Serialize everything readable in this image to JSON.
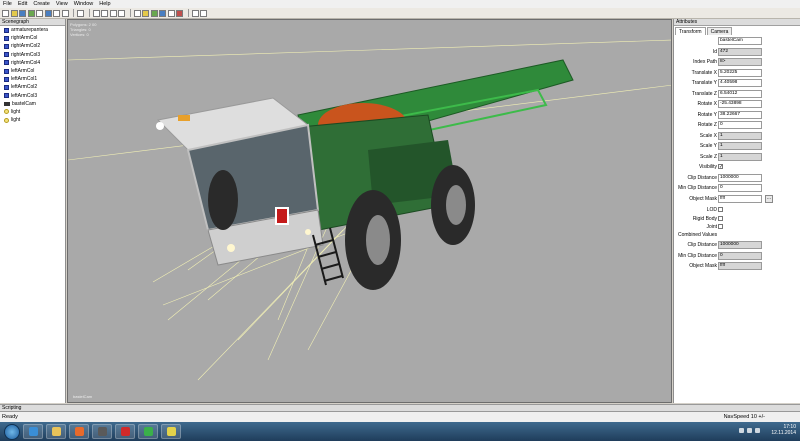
{
  "menu": [
    "File",
    "Edit",
    "Create",
    "View",
    "Window",
    "Help"
  ],
  "scenegraph": {
    "title": "Scenegraph",
    "items": [
      {
        "label": "armaturepantera",
        "icon": "node"
      },
      {
        "label": "rightArmCol",
        "icon": "node"
      },
      {
        "label": "rightArmCol2",
        "icon": "node"
      },
      {
        "label": "rightArmCol3",
        "icon": "node"
      },
      {
        "label": "rightArmCol4",
        "icon": "node"
      },
      {
        "label": "leftArmCol",
        "icon": "node"
      },
      {
        "label": "leftArmCol1",
        "icon": "node"
      },
      {
        "label": "leftArmCol2",
        "icon": "node"
      },
      {
        "label": "leftArmCol3",
        "icon": "node"
      },
      {
        "label": "bastelCam",
        "icon": "camera"
      },
      {
        "label": "light",
        "icon": "light"
      },
      {
        "label": "light",
        "icon": "light"
      }
    ]
  },
  "viewport": {
    "info": [
      "Polygons: 2 00",
      "Triangles: 0",
      "Vertices: 0"
    ],
    "camera_label": "bastelCam"
  },
  "attributes": {
    "title": "Attributes",
    "tabs": [
      "Transform",
      "Camera"
    ],
    "rows": [
      {
        "label": "",
        "value": "bastelCam",
        "ro": false
      },
      {
        "label": "Id",
        "value": "472",
        "ro": true
      },
      {
        "label": "Index Path",
        "value": "8>",
        "ro": true
      },
      {
        "label": "Translate X",
        "value": "5.20225",
        "ro": false
      },
      {
        "label": "Translate Y",
        "value": "4.40598",
        "ro": false
      },
      {
        "label": "Translate Z",
        "value": "6.54012",
        "ro": false
      },
      {
        "label": "Rotate X",
        "value": "-25.43898",
        "ro": false
      },
      {
        "label": "Rotate Y",
        "value": "38.22667",
        "ro": false
      },
      {
        "label": "Rotate Z",
        "value": "0",
        "ro": false
      },
      {
        "label": "Scale X",
        "value": "1",
        "ro": true
      },
      {
        "label": "Scale Y",
        "value": "1",
        "ro": true
      },
      {
        "label": "Scale Z",
        "value": "1",
        "ro": true
      }
    ],
    "visibility_label": "Visibility",
    "visibility_mark": "✓",
    "clip_label": "Clip Distance",
    "clip_value": "1000000",
    "minclip_label": "Min Clip Distance",
    "minclip_value": "0",
    "mask_label": "Object Mask",
    "mask_value": "ffff",
    "mask_btn": "...",
    "lod_label": "LOD",
    "rigid_label": "Rigid Body",
    "joint_label": "Joint",
    "combined_title": "Combined Values",
    "c_clip_label": "Clip Distance",
    "c_clip_value": "1000000",
    "c_minclip_label": "Min Clip Distance",
    "c_minclip_value": "0",
    "c_mask_label": "Object Mask",
    "c_mask_value": "ffff"
  },
  "scripting_title": "Scripting",
  "status": {
    "text": "Ready",
    "nav": "NavSpeed 10 +/-"
  },
  "clock": {
    "time": "17:10",
    "date": "12.11.2014"
  },
  "colors": {
    "viewport_bg": "#a9a9a9",
    "vehicle_green": "#2f7a3c",
    "camera_lines": "#f2f0b5"
  }
}
